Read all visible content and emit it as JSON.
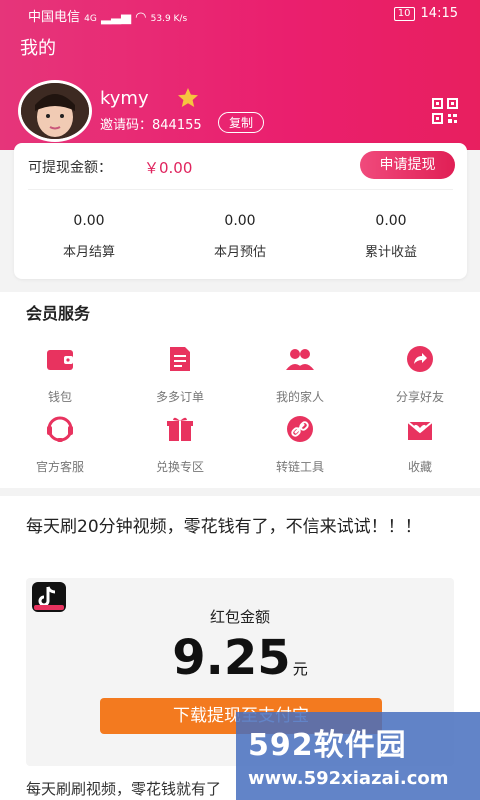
{
  "status": {
    "carrier": "中国电信",
    "network": "4G",
    "speed": "53.9 K/s",
    "battery": "10",
    "time": "14:15"
  },
  "header": {
    "title": "我的"
  },
  "profile": {
    "username": "kymy",
    "invite_text": "邀请码：844155",
    "copy_label": "复制"
  },
  "wallet": {
    "withdraw_label": "可提现金额：",
    "withdraw_amount": "￥0.00",
    "apply_label": "申请提现"
  },
  "stats": [
    {
      "value": "0.00",
      "label": "本月结算"
    },
    {
      "value": "0.00",
      "label": "本月预估"
    },
    {
      "value": "0.00",
      "label": "累计收益"
    }
  ],
  "member": {
    "title": "会员服务",
    "items": [
      {
        "label": "钱包",
        "icon": "wallet-icon"
      },
      {
        "label": "多多订单",
        "icon": "order-icon"
      },
      {
        "label": "我的家人",
        "icon": "family-icon"
      },
      {
        "label": "分享好友",
        "icon": "share-icon"
      },
      {
        "label": "官方客服",
        "icon": "support-icon"
      },
      {
        "label": "兑换专区",
        "icon": "gift-icon"
      },
      {
        "label": "转链工具",
        "icon": "link-icon"
      },
      {
        "label": "收藏",
        "icon": "favorite-icon"
      }
    ]
  },
  "promo": {
    "headline": "每天刷20分钟视频，零花钱有了，不信来试试！！！",
    "red_label": "红包金额",
    "red_value": "9.25",
    "red_unit": "元",
    "download_label": "下载提现至支付宝",
    "bottom_text": "每天刷刷视频，零花钱就有了"
  },
  "watermark": {
    "main": "592软件园",
    "url": "www.592xiazai.com"
  },
  "colors": {
    "accent": "#e81f6e",
    "orange": "#f37a1f"
  }
}
